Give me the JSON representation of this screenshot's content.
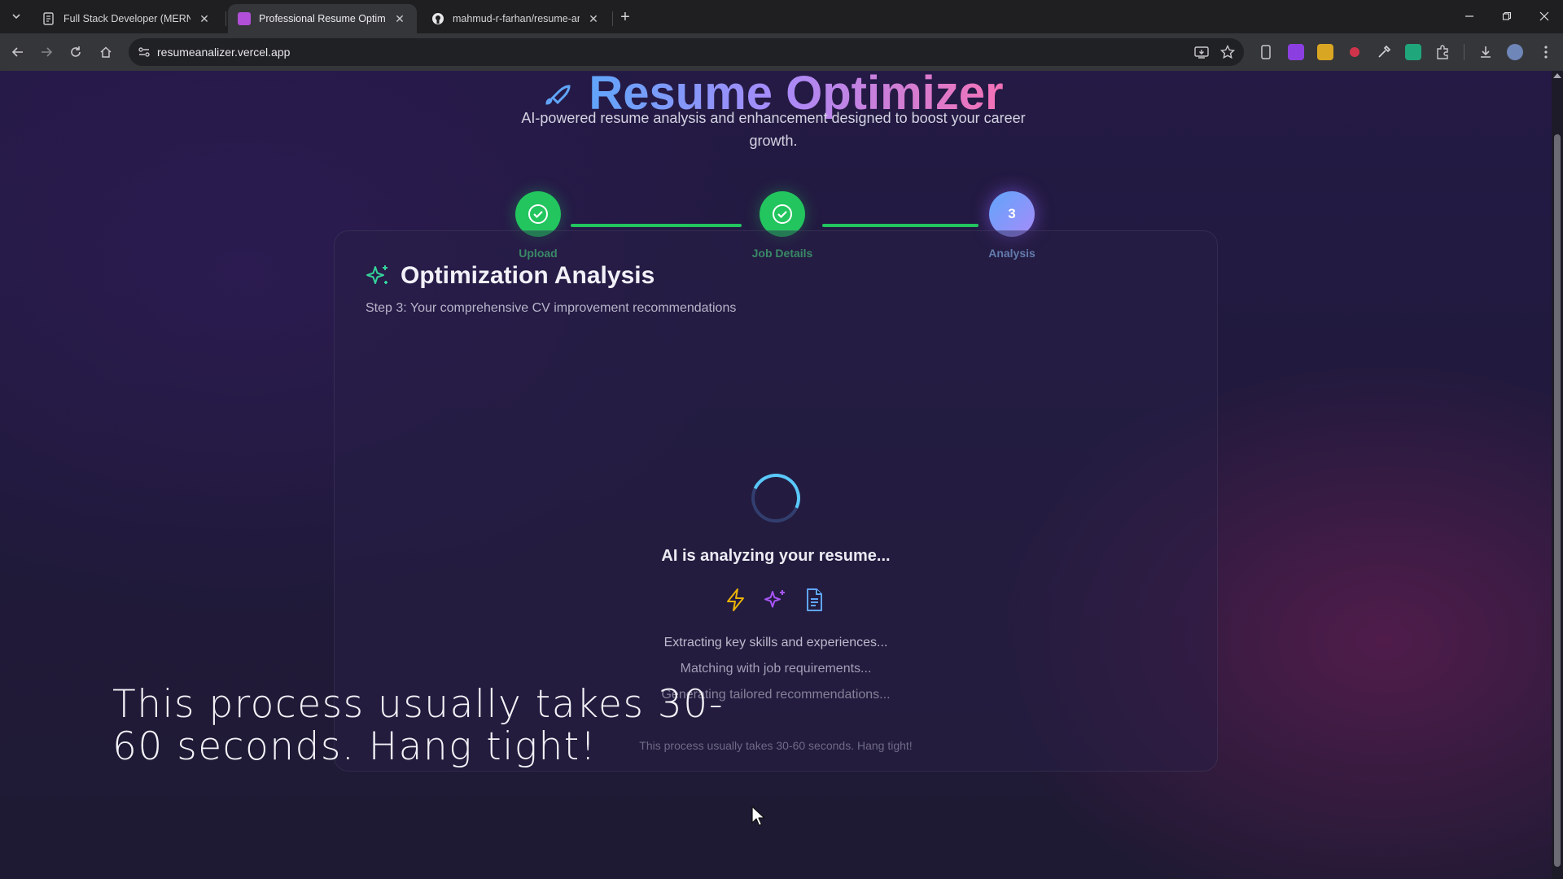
{
  "browser": {
    "tabs": [
      {
        "title": "Full Stack Developer (MERN Sta",
        "active": false,
        "favicon_color": "#9aa0a6"
      },
      {
        "title": "Professional Resume Optimizer",
        "active": true,
        "favicon_color": "#b14fd8"
      },
      {
        "title": "mahmud-r-farhan/resume-anal",
        "active": false,
        "favicon_color": "#e8e8eb"
      }
    ],
    "url": "resumeanalizer.vercel.app",
    "icons": [
      "tab-search-icon",
      "back-icon",
      "forward-icon",
      "reload-icon",
      "home-icon",
      "site-info-icon",
      "install-icon",
      "bookmark-star-icon",
      "extensions-puzzle-icon",
      "download-icon",
      "profile-avatar",
      "menu-kebab-icon"
    ]
  },
  "page": {
    "hero_title": "Resume Optimizer",
    "subtitle": "AI-powered resume analysis and enhancement designed to boost your career growth.",
    "steps": [
      {
        "label": "Upload",
        "state": "done"
      },
      {
        "label": "Job Details",
        "state": "done"
      },
      {
        "label": "Analysis",
        "state": "current",
        "number": "3"
      }
    ],
    "card": {
      "title": "Optimization Analysis",
      "subtitle": "Step 3: Your comprehensive CV improvement recommendations",
      "analyzing": "AI is analyzing your resume...",
      "status_lines": [
        "Extracting key skills and experiences...",
        "Matching with job requirements...",
        "Generating tailored recommendations..."
      ],
      "note": "This process usually takes 30-60 seconds. Hang tight!"
    },
    "caption": "This process usually takes 30-60 seconds. Hang tight!"
  },
  "colors": {
    "accent_green": "#22c55e",
    "accent_blue": "#60a5fa",
    "accent_purple": "#a78bfa",
    "accent_pink": "#f472b6",
    "spinner": "#5ac8fa"
  }
}
